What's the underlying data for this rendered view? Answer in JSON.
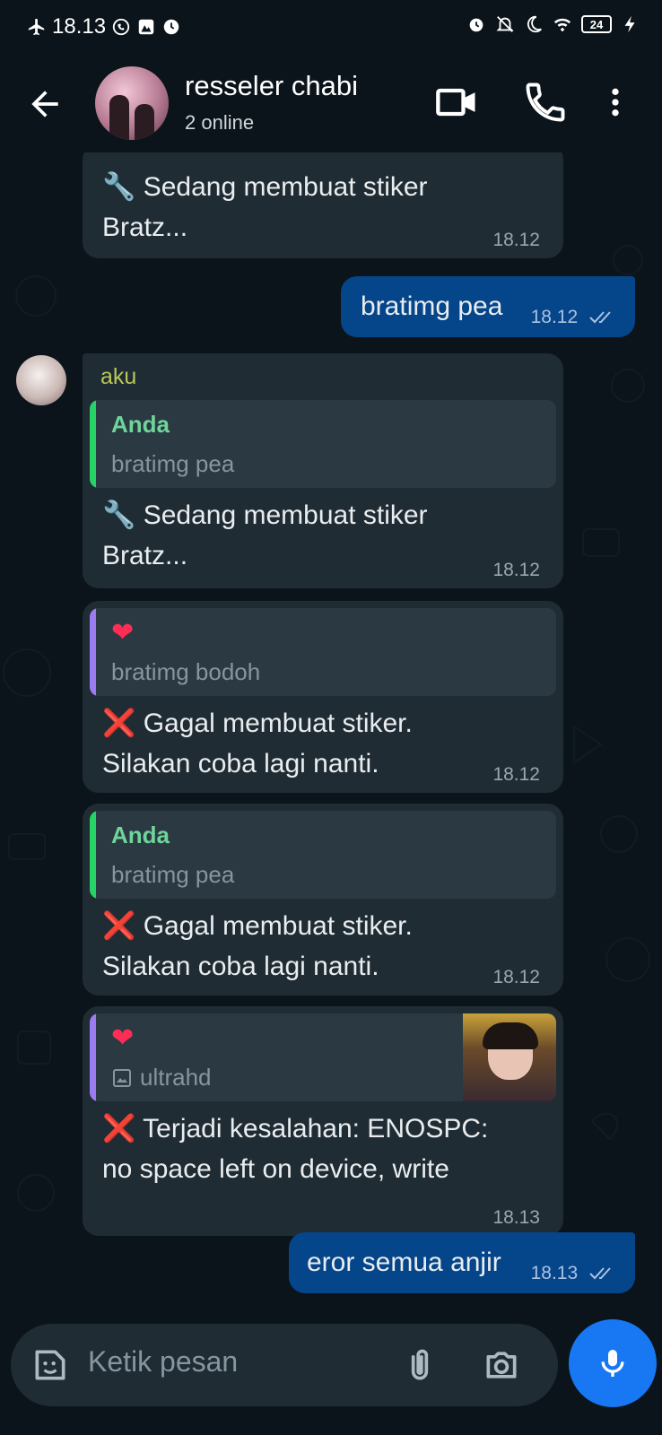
{
  "status_bar": {
    "time": "18.13",
    "battery": "24"
  },
  "header": {
    "title": "resseler chabi",
    "subtitle": "2 online"
  },
  "messages": {
    "m1": {
      "emoji": "🔧",
      "line1": "Sedang membuat stiker",
      "line2": "Bratz...",
      "time": "18.12"
    },
    "m2": {
      "text": "bratimg pea",
      "time": "18.12"
    },
    "m3": {
      "sender": "aku",
      "quote_name": "Anda",
      "quote_text": "bratimg pea",
      "emoji": "🔧",
      "line1": "Sedang membuat stiker",
      "line2": "Bratz...",
      "time": "18.12"
    },
    "m4": {
      "quote_emoji": "❤",
      "quote_text": "bratimg bodoh",
      "emoji": "❌",
      "line1": "Gagal membuat stiker.",
      "line2": "Silakan coba lagi nanti.",
      "time": "18.12"
    },
    "m5": {
      "quote_name": "Anda",
      "quote_text": "bratimg pea",
      "emoji": "❌",
      "line1": "Gagal membuat stiker.",
      "line2": "Silakan coba lagi nanti.",
      "time": "18.12"
    },
    "m6": {
      "quote_emoji": "❤",
      "quote_text": "ultrahd",
      "emoji": "❌",
      "line1": "Terjadi kesalahan: ENOSPC:",
      "line2": "no space left on device, write",
      "time": "18.13"
    },
    "m7": {
      "text": "eror semua anjir",
      "time": "18.13"
    }
  },
  "composer": {
    "placeholder": "Ketik pesan"
  },
  "colors": {
    "accent_blue": "#1877f2",
    "outgoing_bubble": "#05458a",
    "incoming_bubble": "#202c33",
    "quote_green": "#25d366",
    "quote_purple": "#9b7cf0"
  }
}
